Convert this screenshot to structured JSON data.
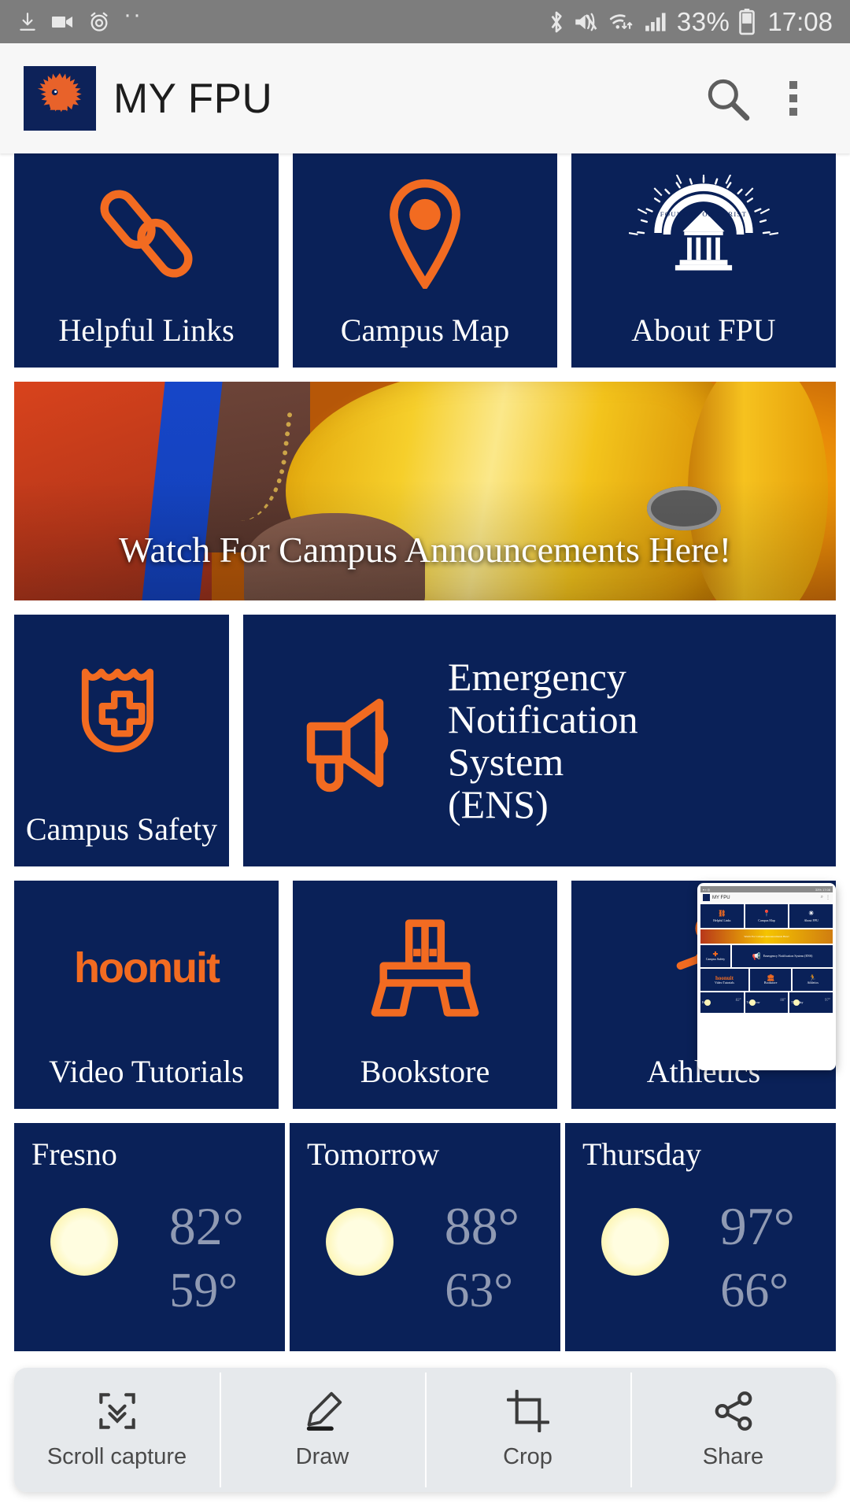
{
  "status_bar": {
    "icons_left": [
      "download-icon",
      "video-recorder-icon",
      "alarm-icon",
      "more-dots-icon"
    ],
    "icons_right": [
      "bluetooth-icon",
      "mute-vibrate-icon",
      "wifi-icon",
      "cellular-signal-icon"
    ],
    "battery_percent": "33%",
    "time": "17:08"
  },
  "app_bar": {
    "logo_name": "fpu-sunbird-logo",
    "title": "MY FPU",
    "search_icon": "search-icon",
    "overflow_icon": "more-vertical-icon"
  },
  "tiles_row1": [
    {
      "label": "Helpful Links",
      "icon": "chain-link-icon"
    },
    {
      "label": "Campus Map",
      "icon": "map-pin-icon"
    },
    {
      "label": "About FPU",
      "icon": "founded-on-christ-seal-icon",
      "seal_text": "FOUNDED ON CHRIST"
    }
  ],
  "banner": {
    "caption": "Watch For Campus Announcements Here!",
    "image_name": "megaphone-photo"
  },
  "tiles_row2": [
    {
      "label": "Campus Safety",
      "icon": "shield-medical-cross-icon"
    },
    {
      "label": "Emergency\nNotification\nSystem\n(ENS)",
      "label_lines": [
        "Emergency",
        "Notification",
        "System",
        "(ENS)"
      ],
      "icon": "bullhorn-icon"
    }
  ],
  "tiles_row3": [
    {
      "label": "Video Tutorials",
      "icon": "hoonuit-logo",
      "logo_text": "hoonuit"
    },
    {
      "label": "Bookstore",
      "icon": "bookstore-building-icon"
    },
    {
      "label": "Athletics",
      "icon": "runner-icon"
    }
  ],
  "weather": [
    {
      "title": "Fresno",
      "icon": "sun-icon",
      "high": "82°",
      "low": "59°"
    },
    {
      "title": "Tomorrow",
      "icon": "sun-icon",
      "high": "88°",
      "low": "63°"
    },
    {
      "title": "Thursday",
      "icon": "sun-icon",
      "high": "97°",
      "low": "66°"
    }
  ],
  "screenshot_toolbar": [
    {
      "label": "Scroll capture",
      "icon": "scroll-capture-icon"
    },
    {
      "label": "Draw",
      "icon": "pen-icon"
    },
    {
      "label": "Crop",
      "icon": "crop-icon"
    },
    {
      "label": "Share",
      "icon": "share-icon"
    }
  ],
  "thumbnail_preview": {
    "name": "screenshot-thumbnail",
    "status_left": "icons",
    "status_right": "33% 17:08",
    "title": "MY FPU",
    "tiles": [
      "Helpful Links",
      "Campus Map",
      "About FPU"
    ],
    "banner_caption": "Watch For Campus Announcements Here!",
    "safety": "Campus Safety",
    "ens": "Emergency Notification System (ENS)",
    "hoonuit": "hoonuit",
    "video": "Video Tutorials",
    "bookstore": "Bookstore",
    "athletics": "Athletics",
    "w1": "Fresno",
    "w1t": "82°",
    "w2": "Tomorrow",
    "w2t": "88°",
    "w3": "Thursday",
    "w3t": "97°"
  },
  "colors": {
    "brand_navy": "#0a2158",
    "brand_orange": "#f26b21",
    "status_bar": "#7d7d7d",
    "app_bar": "#f7f7f7"
  }
}
